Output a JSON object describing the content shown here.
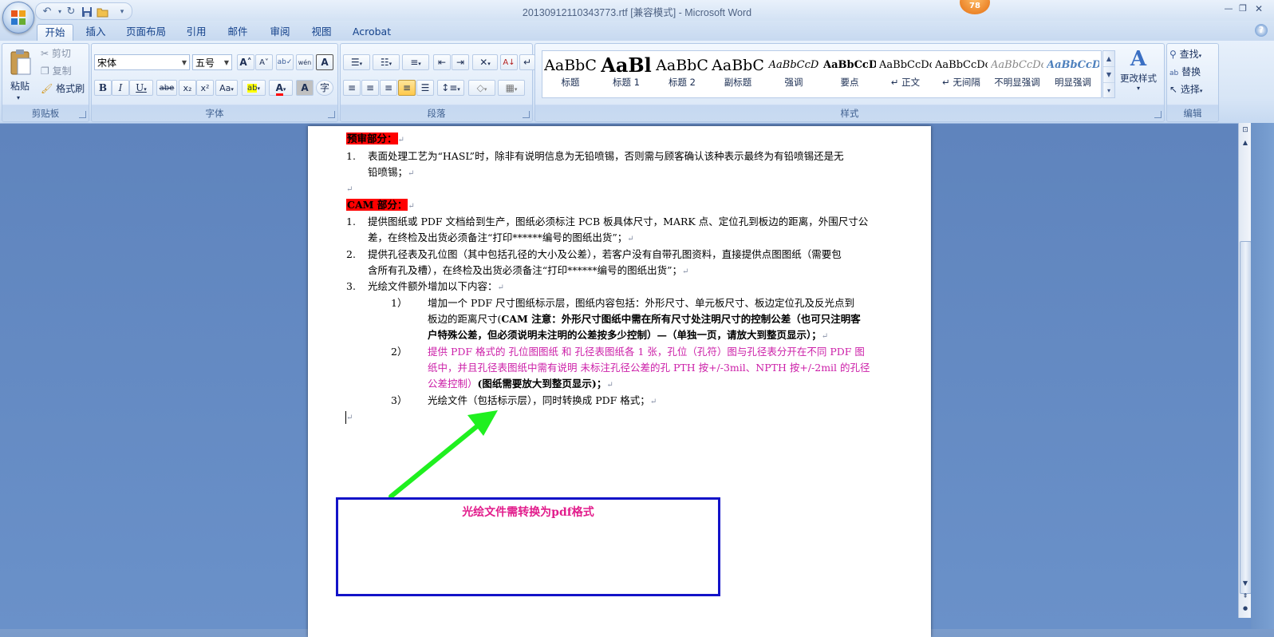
{
  "window": {
    "title": "20130912110343773.rtf [兼容模式] - Microsoft Word",
    "badge": "78"
  },
  "tabs": [
    {
      "label": "开始"
    },
    {
      "label": "插入"
    },
    {
      "label": "页面布局"
    },
    {
      "label": "引用"
    },
    {
      "label": "邮件"
    },
    {
      "label": "审阅"
    },
    {
      "label": "视图"
    },
    {
      "label": "Acrobat"
    }
  ],
  "clipboard": {
    "paste": "粘贴",
    "cut": "剪切",
    "copy": "复制",
    "format_painter": "格式刷",
    "label": "剪贴板"
  },
  "font": {
    "name": "宋体",
    "size": "五号",
    "label": "字体",
    "grow": "A",
    "shrink": "A",
    "bold": "B",
    "italic": "I",
    "underline": "U",
    "strike": "abe",
    "subscript": "x₂",
    "superscript": "x²",
    "case": "Aa"
  },
  "paragraph": {
    "label": "段落"
  },
  "styles": {
    "label": "样式",
    "items": [
      {
        "sample": "AaBbC",
        "name": "标题"
      },
      {
        "sample": "AaBl",
        "name": "标题 1"
      },
      {
        "sample": "AaBbC",
        "name": "标题 2"
      },
      {
        "sample": "AaBbC",
        "name": "副标题"
      },
      {
        "sample": "AaBbCcD",
        "name": "强调"
      },
      {
        "sample": "AaBbCcD",
        "name": "要点"
      },
      {
        "sample": "AaBbCcDc",
        "name": "↵ 正文"
      },
      {
        "sample": "AaBbCcDc",
        "name": "↵ 无间隔"
      },
      {
        "sample": "AaBbCcDc",
        "name": "不明显强调"
      },
      {
        "sample": "AaBbCcDc",
        "name": "明显强调"
      }
    ],
    "change_styles": "更改样式"
  },
  "editing": {
    "find": "查找",
    "replace": "替换",
    "select": "选择",
    "label": "编辑"
  },
  "document": {
    "section1_title": "预审部分：",
    "s1_item1_num": "1.",
    "s1_item1_a": "表面处理工艺为“HASL”时，除非有说明信息为无铅喷锡，否则需与顾客确认该种表示最终为有铅喷锡还是无",
    "s1_item1_b": "铅喷锡；",
    "section2_title": "CAM 部分：",
    "s2_item1_num": "1.",
    "s2_item1_a": "提供图纸或 PDF 文档给到生产，图纸必须标注 PCB 板具体尺寸，MARK 点、定位孔到板边的距离，外围尺寸公",
    "s2_item1_b": "差，在终检及出货必须备注“打印******编号的图纸出货”；",
    "s2_item2_num": "2.",
    "s2_item2_a": "提供孔径表及孔位图（其中包括孔径的大小及公差），若客户没有自带孔图资料，直接提供点图图纸（需要包",
    "s2_item2_b": "含所有孔及槽），在终检及出货必须备注“打印******编号的图纸出货”；",
    "s2_item3_num": "3.",
    "s2_item3": "光绘文件额外增加以下内容：",
    "sub1_num": "1）",
    "sub1_a": "增加一个 PDF 尺寸图纸标示层，图纸内容包括：外形尺寸、单元板尺寸、板边定位孔及反光点到",
    "sub1_b_plain": "板边的距离尺寸(",
    "sub1_b_bold": "CAM 注意：外形尺寸图纸中需在所有尺寸处注明尺寸的控制公差（也可只注明客",
    "sub1_c": "户特殊公差，但必须说明未注明的公差按多少控制）—（单独一页，请放大到整页显示）；",
    "sub2_num": "2）",
    "sub2_a": "提供 PDF 格式的 孔位图图纸 和 孔径表图纸各 1 张，孔位（孔符）图与孔径表分开在不同 PDF 图",
    "sub2_b": "纸中，并且孔径表图纸中需有说明 未标注孔径公差的孔 PTH 按+/-3mil、NPTH 按+/-2mil 的孔径",
    "sub2_c_mag": "公差控制）",
    "sub2_c_bold": "(图纸需要放大到整页显示)；",
    "sub3_num": "3）",
    "sub3": "光绘文件（包括标示层），同时转换成 PDF 格式；",
    "callout": "光绘文件需转换为pdf格式"
  },
  "colors": {
    "highlight_red": "#ff0000",
    "magenta_text": "#cc1fa8",
    "arrow_green": "#1ff01f",
    "callout_border": "#1313c8",
    "callout_text": "#e21d8c"
  }
}
